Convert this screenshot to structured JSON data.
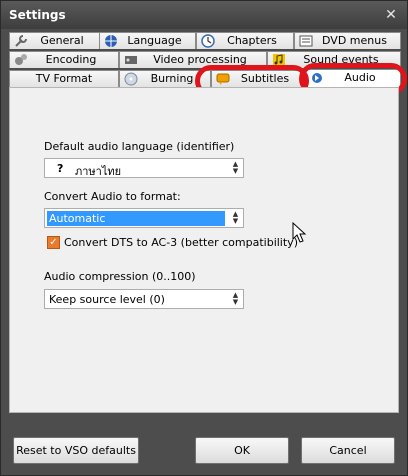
{
  "window": {
    "title": "Settings",
    "close_glyph": "✕"
  },
  "tabs": {
    "row1": [
      {
        "label": "General",
        "icon": "wrench-icon"
      },
      {
        "label": "Language",
        "icon": "globe-icon"
      },
      {
        "label": "Chapters",
        "icon": "clock-icon"
      },
      {
        "label": "DVD menus",
        "icon": "menu-icon"
      }
    ],
    "row2": [
      {
        "label": "Encoding",
        "icon": "gears-icon"
      },
      {
        "label": "Video processing",
        "icon": "video-icon"
      },
      {
        "label": "Sound events",
        "icon": "music-note-icon"
      }
    ],
    "row3": [
      {
        "label": "TV Format",
        "icon": ""
      },
      {
        "label": "Burning",
        "icon": "disc-icon"
      },
      {
        "label": "Subtitles",
        "icon": "subtitles-icon"
      },
      {
        "label": "Audio",
        "icon": "audio-icon",
        "active": true
      }
    ]
  },
  "form": {
    "default_lang_label": "Default audio language (identifier)",
    "default_lang_value_prefix": "?",
    "default_lang_value": "ภาษาไทย",
    "convert_label": "Convert Audio to format:",
    "convert_value": "Automatic",
    "dts_label": "Convert DTS to AC-3 (better compatibility)",
    "dts_checked": true,
    "compression_label": "Audio compression (0..100)",
    "compression_value": "Keep source level (0)"
  },
  "buttons": {
    "reset": "Reset to VSO defaults",
    "ok": "OK",
    "cancel": "Cancel"
  },
  "colors": {
    "accent_highlight": "#3399ff",
    "annotation": "#e0151b",
    "checkbox": "#e87c2c"
  }
}
